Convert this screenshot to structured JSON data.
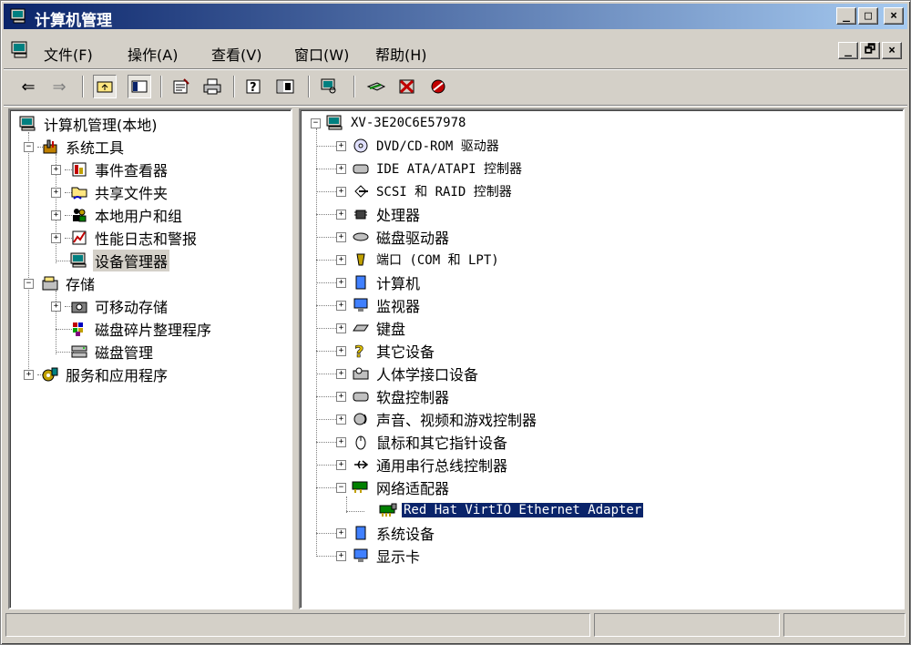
{
  "window": {
    "title": "计算机管理"
  },
  "caption_buttons": {
    "minimize": "_",
    "maximize": "□",
    "close": "×"
  },
  "mdi_buttons": {
    "minimize": "_",
    "restore": "🗗",
    "close": "×"
  },
  "menu": [
    "文件(F)",
    "操作(A)",
    "查看(V)",
    "窗口(W)",
    "帮助(H)"
  ],
  "toolbar": {
    "buttons": [
      "back-arrow-icon",
      "forward-arrow-icon",
      "up-folder-icon",
      "show-tree-icon",
      "properties-icon",
      "print-icon",
      "help-icon",
      "console-icon",
      "scan-hardware-icon",
      "disable-device-icon",
      "uninstall-device-icon",
      "update-driver-icon"
    ]
  },
  "left_tree": {
    "root": "计算机管理(本地)",
    "system_tools": "系统工具",
    "event_viewer": "事件查看器",
    "shared_folders": "共享文件夹",
    "local_users": "本地用户和组",
    "perf_logs": "性能日志和警报",
    "device_manager": "设备管理器",
    "storage": "存储",
    "removable": "可移动存储",
    "defrag": "磁盘碎片整理程序",
    "disk_mgmt": "磁盘管理",
    "services": "服务和应用程序"
  },
  "right_tree": {
    "computer": "XV-3E20C6E57978",
    "categories": [
      "DVD/CD-ROM 驱动器",
      "IDE ATA/ATAPI 控制器",
      "SCSI 和 RAID 控制器",
      "处理器",
      "磁盘驱动器",
      "端口 (COM 和 LPT)",
      "计算机",
      "监视器",
      "键盘",
      "其它设备",
      "人体学接口设备",
      "软盘控制器",
      "声音、视频和游戏控制器",
      "鼠标和其它指针设备",
      "通用串行总线控制器",
      "网络适配器"
    ],
    "network_child": "Red Hat VirtIO Ethernet Adapter",
    "after": [
      "系统设备",
      "显示卡"
    ]
  },
  "colors": {
    "titlebar_start": "#0a246a",
    "titlebar_end": "#a6caf0",
    "selection": "#0a246a",
    "face": "#d4d0c8"
  }
}
